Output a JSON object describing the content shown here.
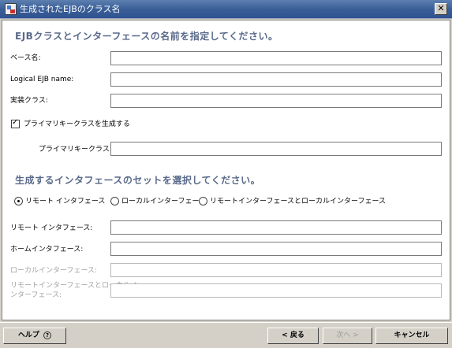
{
  "window": {
    "title": "生成されたEJBのクラス名",
    "close_glyph": "✕"
  },
  "section1": {
    "heading": "EJBクラスとインターフェースの名前を指定してください。",
    "base_name_label": "ベース名:",
    "base_name_value": "",
    "logical_label": "Logical EJB name:",
    "logical_value": "",
    "impl_label": "実装クラス:",
    "impl_value": "",
    "pk_checkbox_label": "プライマリキークラスを生成する",
    "pk_checked": true,
    "pk_label": "プライマリキークラス:",
    "pk_value": ""
  },
  "section2": {
    "heading": "生成するインタフェースのセットを選択してください。",
    "radios": [
      {
        "label": "リモート インタフェース",
        "selected": true
      },
      {
        "label": "ローカルインターフェース",
        "selected": false
      },
      {
        "label": "リモートインターフェースとローカルインターフェース",
        "selected": false
      }
    ],
    "remote_label": "リモート インタフェース:",
    "home_label": "ホームインタフェース:",
    "local_label": "ローカルインターフェース:",
    "local_home_label_line1": "リモートインターフェースとローカルイ",
    "local_home_label_line2": "ンターフェース:"
  },
  "footer": {
    "help": "ヘルプ",
    "help_icon": "?",
    "back": "< 戻る",
    "next": "次へ >",
    "cancel": "キャンセル"
  },
  "colors": {
    "title_bar": "#3a5f98",
    "heading": "#5a6a8a"
  }
}
